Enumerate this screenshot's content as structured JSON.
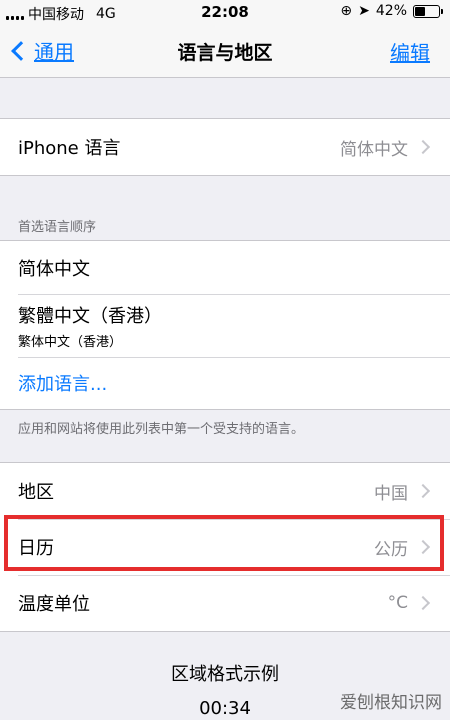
{
  "status_bar": {
    "carrier": "中国移动",
    "network": "4G",
    "time": "22:08",
    "battery": "42%",
    "battery_level": 0.42
  },
  "nav": {
    "back_label": "通用",
    "title": "语言与地区",
    "edit_label": "编辑"
  },
  "iphone_language": {
    "label": "iPhone 语言",
    "value": "简体中文"
  },
  "preferred_languages": {
    "header": "首选语言顺序",
    "items": [
      {
        "label": "简体中文"
      },
      {
        "label": "繁體中文（香港）",
        "sublabel": "繁体中文（香港）"
      }
    ],
    "add_label": "添加语言...",
    "footer": "应用和网站将使用此列表中第一个受支持的语言。"
  },
  "region_settings": [
    {
      "label": "地区",
      "value": "中国"
    },
    {
      "label": "日历",
      "value": "公历"
    },
    {
      "label": "温度单位",
      "value": "°C"
    }
  ],
  "format_example": {
    "title": "区域格式示例",
    "time": "00:34"
  },
  "watermark": "爱刨根知识网"
}
